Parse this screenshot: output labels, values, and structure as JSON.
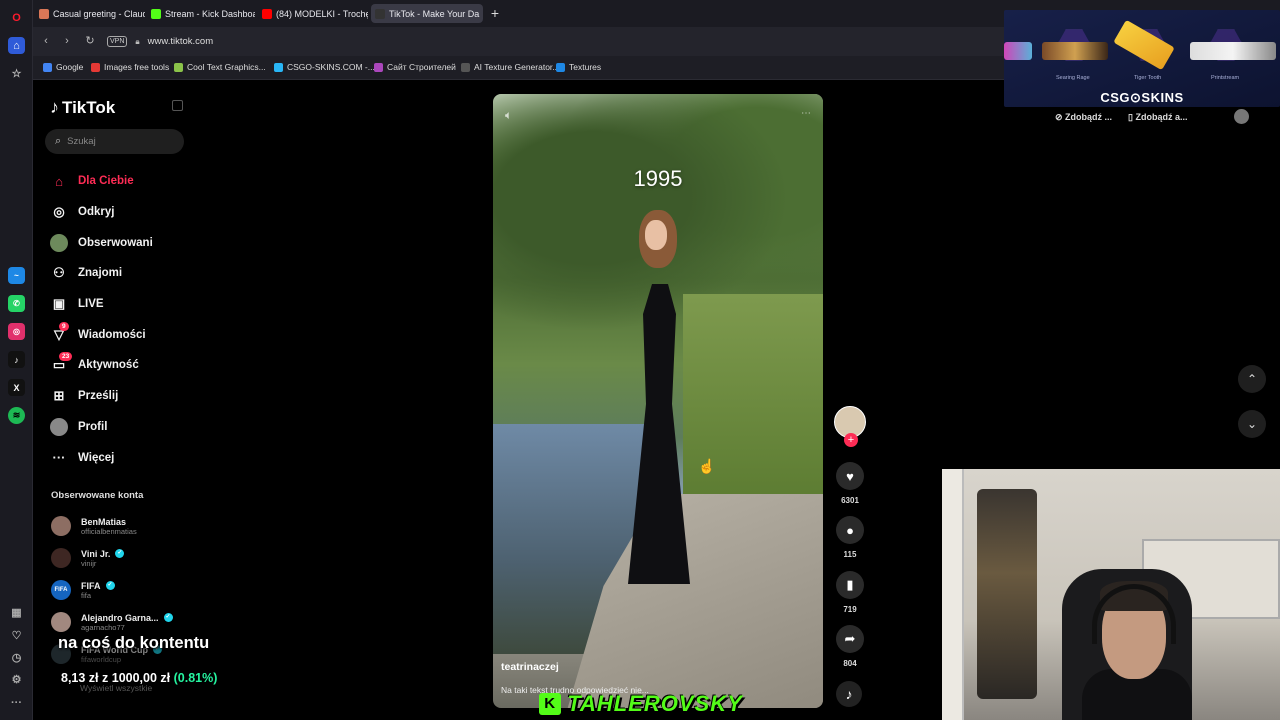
{
  "browser": {
    "tabs": [
      {
        "label": "Casual greeting - Claude",
        "color": "#d97757"
      },
      {
        "label": "Stream - Kick Dashboard",
        "color": "#53fc18"
      },
      {
        "label": "(84) MODELKI - Trochę Za",
        "color": "#ff0000"
      },
      {
        "label": "TikTok - Make Your Da",
        "color": "#111111"
      }
    ],
    "new_tab": "+",
    "url": "www.tiktok.com",
    "vpn": "VPN",
    "bookmarks": [
      {
        "label": "Google",
        "color": "#4285f4"
      },
      {
        "label": "Images free tools",
        "color": "#e53935"
      },
      {
        "label": "Cool Text Graphics...",
        "color": "#8bc34a"
      },
      {
        "label": "CSGO-SKINS.COM -...",
        "color": "#29b6f6"
      },
      {
        "label": "Сайт Строителей",
        "color": "#ab47bc"
      },
      {
        "label": "AI Texture Generator...",
        "color": "#555555"
      },
      {
        "label": "Textures",
        "color": "#1e88e5"
      }
    ]
  },
  "tiktok": {
    "logo": "TikTok",
    "search_placeholder": "Szukaj",
    "nav": [
      {
        "label": "Dla Ciebie",
        "icon": "home-icon",
        "glyph": "⌂",
        "active": true
      },
      {
        "label": "Odkryj",
        "icon": "compass-icon",
        "glyph": "◎"
      },
      {
        "label": "Obserwowani",
        "icon": "following-avatar-icon",
        "glyph": "●"
      },
      {
        "label": "Znajomi",
        "icon": "friends-icon",
        "glyph": "⚇"
      },
      {
        "label": "LIVE",
        "icon": "live-icon",
        "glyph": "▣"
      },
      {
        "label": "Wiadomości",
        "icon": "messages-icon",
        "glyph": "▽",
        "badge": "9"
      },
      {
        "label": "Aktywność",
        "icon": "activity-icon",
        "glyph": "▭",
        "badge": "23"
      },
      {
        "label": "Prześlij",
        "icon": "upload-icon",
        "glyph": "⊞"
      },
      {
        "label": "Profil",
        "icon": "profile-icon",
        "glyph": "●"
      },
      {
        "label": "Więcej",
        "icon": "more-icon",
        "glyph": "···"
      }
    ],
    "followed_title": "Obserwowane konta",
    "accounts": [
      {
        "name": "BenMatias",
        "handle": "officialbenmatias",
        "verified": false,
        "color": "#8d6e63"
      },
      {
        "name": "Vini Jr.",
        "handle": "vinijr",
        "verified": true,
        "color": "#3e2723"
      },
      {
        "name": "FIFA",
        "handle": "fifa",
        "verified": true,
        "color": "#1565c0",
        "initials": "FIFA"
      },
      {
        "name": "Alejandro Garna...",
        "handle": "agarnacho77",
        "verified": true,
        "color": "#a1887f"
      },
      {
        "name": "FIFA World Cup",
        "handle": "fifaworldcup",
        "verified": true,
        "color": "#37474f"
      }
    ],
    "see_all": "Wyświetl wszystkie"
  },
  "stream_overlay": {
    "text1": "na coś do kontentu",
    "amount": "8,13 zł",
    "of": "z",
    "goal": "1000,00 zł",
    "percent": "(0.81%)",
    "banner": "TAHLEROVSKY",
    "banner_k": "K"
  },
  "video": {
    "overlay_text": "1995",
    "author": "teatrinaczej",
    "caption": "Na taki tekst trudno odpowiedzieć nie..."
  },
  "actions": {
    "likes": "6301",
    "comments": "115",
    "saves": "719",
    "shares": "804"
  },
  "ad": {
    "title": "CSG⊙SKINS",
    "items": [
      "Searing Rage",
      "Tiger Tooth",
      "Printstream"
    ],
    "buttons": [
      "Zdobądź ...",
      "Zdobądź a..."
    ]
  }
}
